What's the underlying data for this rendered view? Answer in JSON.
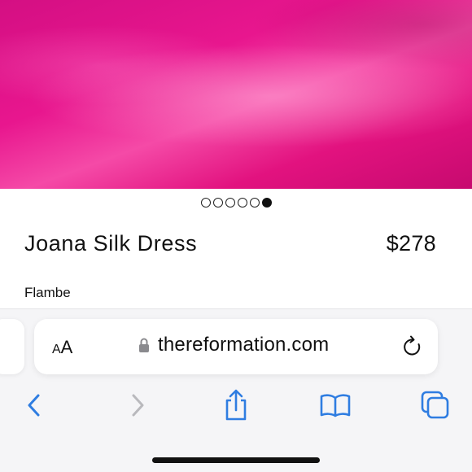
{
  "product": {
    "name": "Joana Silk Dress",
    "price": "$278",
    "color": "Flambe",
    "image_color": "#e8168e"
  },
  "carousel": {
    "total": 6,
    "active_index": 5
  },
  "browser": {
    "aa_label_small": "A",
    "aa_label_large": "A",
    "url": "thereformation.com",
    "accent": "#2f7de1"
  },
  "icons": {
    "lock": "lock-icon",
    "reload": "reload-icon",
    "back": "back-icon",
    "forward": "forward-icon",
    "share": "share-icon",
    "bookmarks": "bookmarks-icon",
    "tabs": "tabs-icon"
  }
}
